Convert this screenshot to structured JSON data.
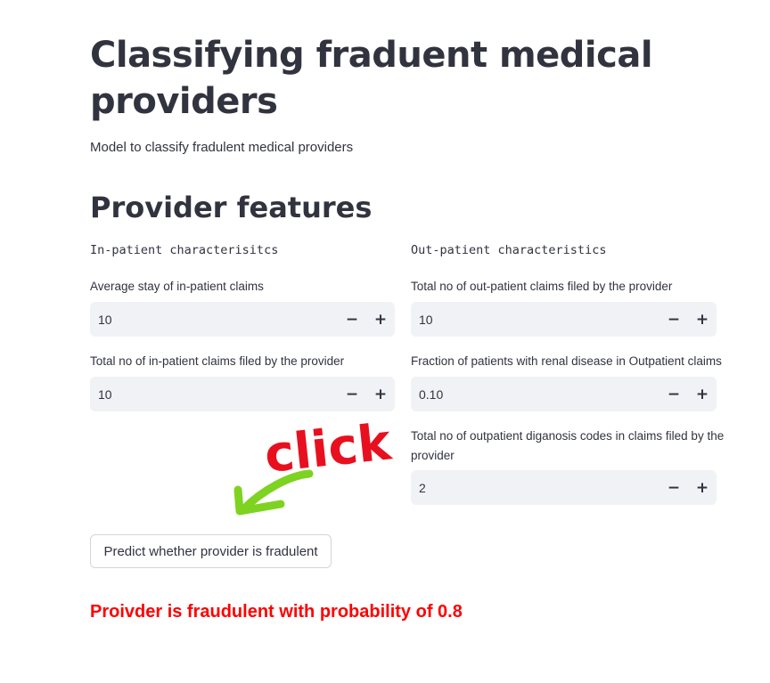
{
  "header": {
    "title": "Classifying fraduent medical providers",
    "subtitle": "Model to classify fradulent medical providers"
  },
  "section": {
    "heading": "Provider features"
  },
  "inpatient": {
    "heading": "In-patient characterisitcs",
    "avg_stay": {
      "label": "Average stay of in-patient claims",
      "value": "10"
    },
    "total_claims": {
      "label": "Total no of in-patient claims filed by the provider",
      "value": "10"
    }
  },
  "outpatient": {
    "heading": "Out-patient characteristics",
    "total_claims": {
      "label": "Total no of out-patient claims filed by the provider",
      "value": "10"
    },
    "renal_fraction": {
      "label": "Fraction of patients with renal disease in Outpatient claims",
      "value": "0.10"
    },
    "diag_codes": {
      "label": "Total no of outpatient diganosis codes in claims filed by the provider",
      "value": "2"
    }
  },
  "stepper": {
    "minus": "−",
    "plus": "+"
  },
  "annotation": {
    "text": "click",
    "text_color": "#e8101e",
    "arrow_color": "#7ed321"
  },
  "predict_button": {
    "label": "Predict whether provider is fradulent"
  },
  "result": {
    "text": "Proivder is fraudulent with probability of 0.8",
    "color": "#ff0000"
  }
}
